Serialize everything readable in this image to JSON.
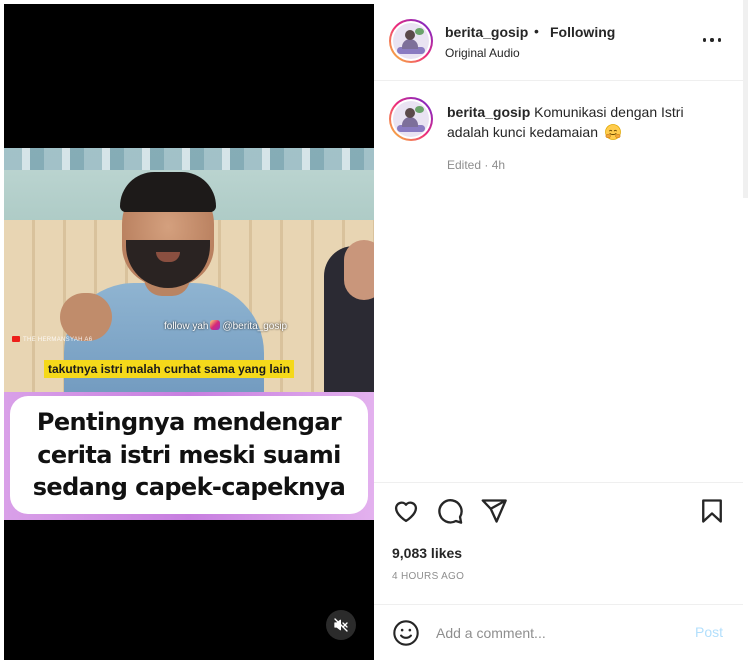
{
  "post": {
    "username": "berita_gosip",
    "separator": "•",
    "follow_status": "Following",
    "audio": "Original Audio"
  },
  "video": {
    "watermark_prefix": "follow yah",
    "watermark_handle": "@berita_gosip",
    "channel": "THE HERMANSYAH A6",
    "subtitle": "takutnya istri malah curhat sama yang lain",
    "caption": "Pentingnya mendengar\ncerita istri meski suami\nsedang capek-capeknya",
    "mute_icon": "muted-speaker-icon"
  },
  "caption_comment": {
    "username": "berita_gosip",
    "text": "Komunikasi dengan Istri adalah kunci kedamaian",
    "emoji": "hugging-face-emoji",
    "meta": "Edited · 4h"
  },
  "actions": {
    "icons": [
      "heart-icon",
      "comment-icon",
      "share-icon",
      "bookmark-icon"
    ],
    "likes": "9,083 likes",
    "time": "4 HOURS AGO"
  },
  "add_comment": {
    "placeholder": "Add a comment...",
    "post_label": "Post",
    "emoji_icon": "smiley-icon"
  },
  "colors": {
    "text": "#262626",
    "muted": "#8e8e8e",
    "post_disabled": "#b2dffc",
    "subtitle_bg": "#f5d91a",
    "caption_band": "#c77ee0"
  }
}
